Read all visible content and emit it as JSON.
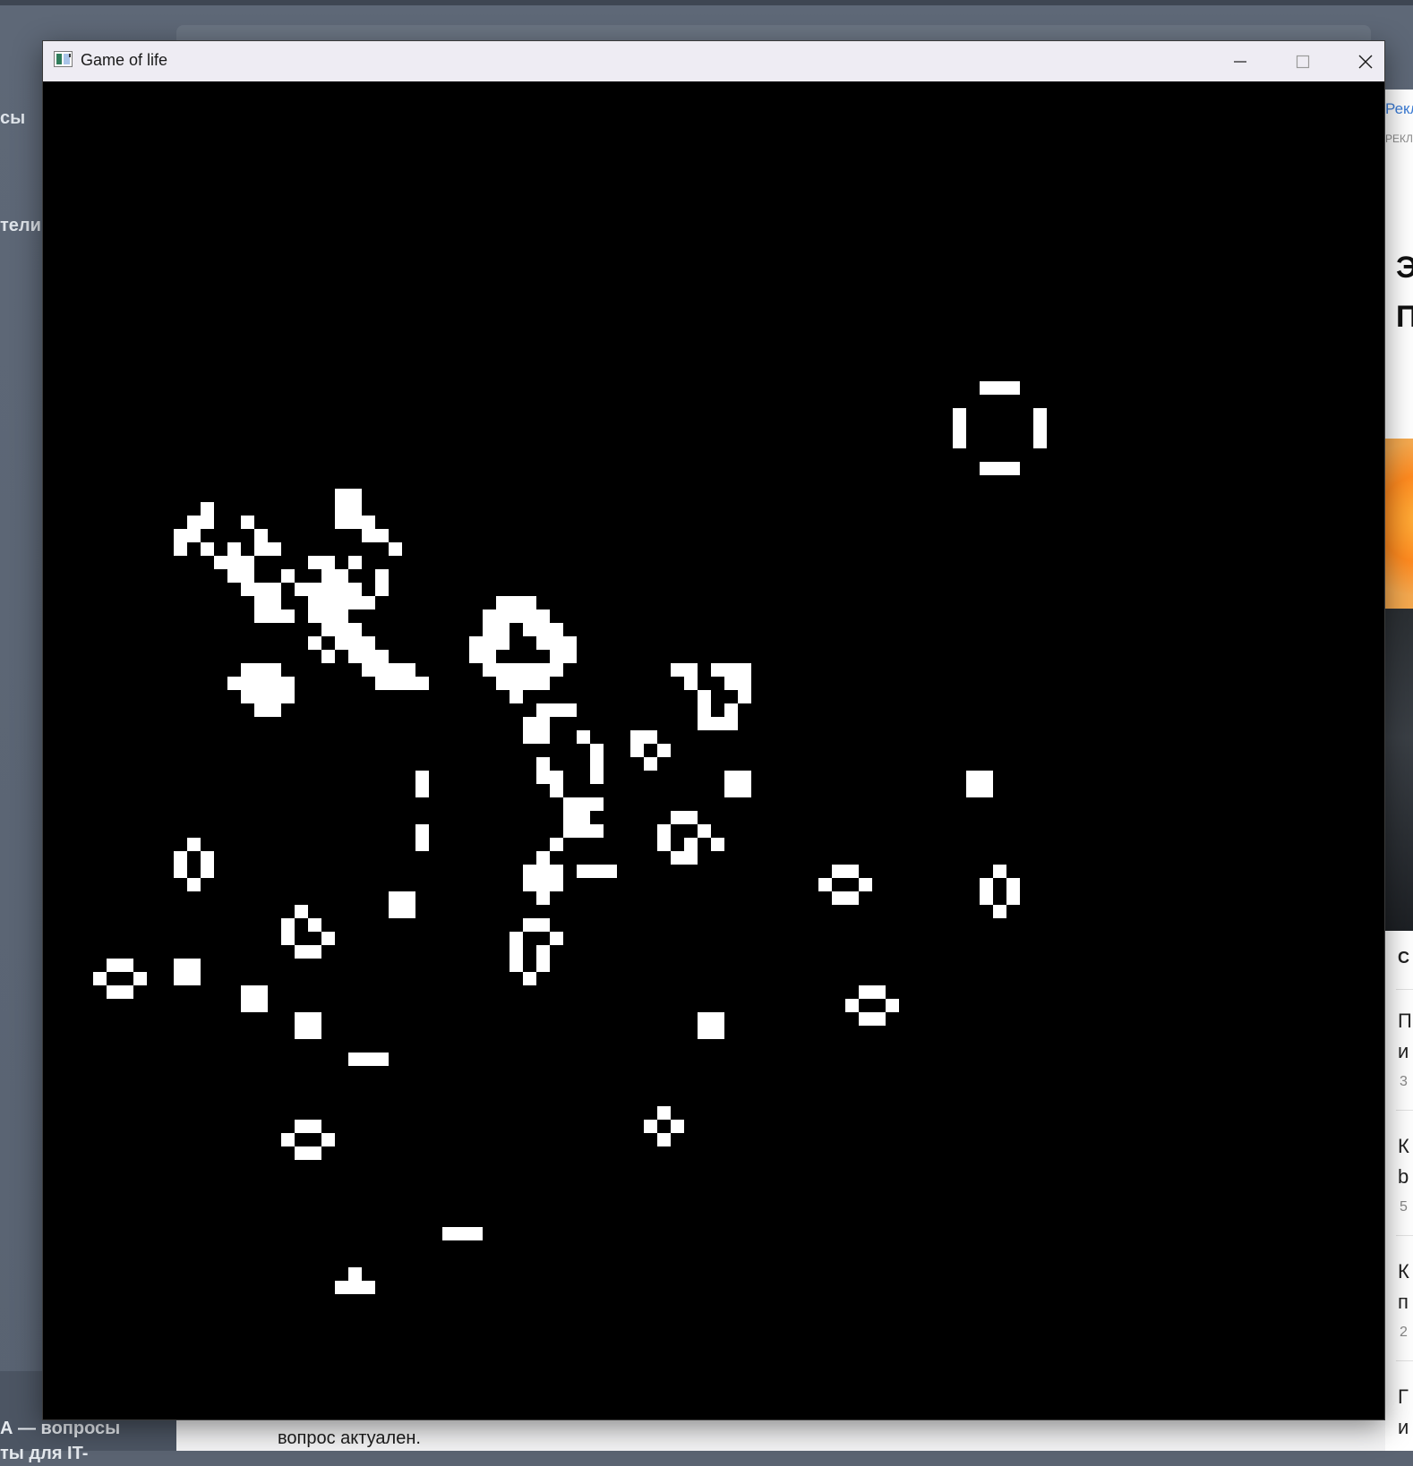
{
  "window": {
    "title": "Game of life",
    "icon": "app-icon",
    "controls": {
      "minimize": "minimize-icon",
      "maximize": "maximize-icon",
      "close": "close-icon"
    }
  },
  "game": {
    "alive_color": "#ffffff",
    "dead_color": "#000000",
    "cell_size": 15,
    "alive_cells": [
      [
        70,
        23
      ],
      [
        71,
        23
      ],
      [
        72,
        23
      ],
      [
        68,
        25
      ],
      [
        74,
        25
      ],
      [
        68,
        26
      ],
      [
        74,
        26
      ],
      [
        68,
        27
      ],
      [
        74,
        27
      ],
      [
        70,
        29
      ],
      [
        71,
        29
      ],
      [
        72,
        29
      ],
      [
        22,
        31
      ],
      [
        23,
        31
      ],
      [
        22,
        32
      ],
      [
        23,
        32
      ],
      [
        22,
        33
      ],
      [
        23,
        33
      ],
      [
        24,
        33
      ],
      [
        24,
        34
      ],
      [
        25,
        34
      ],
      [
        12,
        32
      ],
      [
        11,
        33
      ],
      [
        12,
        33
      ],
      [
        15,
        33
      ],
      [
        10,
        34
      ],
      [
        11,
        34
      ],
      [
        16,
        34
      ],
      [
        10,
        35
      ],
      [
        12,
        35
      ],
      [
        16,
        35
      ],
      [
        13,
        36
      ],
      [
        14,
        35
      ],
      [
        17,
        35
      ],
      [
        26,
        35
      ],
      [
        13,
        36
      ],
      [
        14,
        36
      ],
      [
        15,
        36
      ],
      [
        20,
        36
      ],
      [
        21,
        36
      ],
      [
        23,
        36
      ],
      [
        14,
        37
      ],
      [
        15,
        37
      ],
      [
        18,
        37
      ],
      [
        21,
        37
      ],
      [
        22,
        37
      ],
      [
        25,
        37
      ],
      [
        15,
        38
      ],
      [
        16,
        38
      ],
      [
        17,
        38
      ],
      [
        19,
        38
      ],
      [
        20,
        38
      ],
      [
        21,
        38
      ],
      [
        22,
        38
      ],
      [
        23,
        38
      ],
      [
        25,
        38
      ],
      [
        16,
        39
      ],
      [
        17,
        39
      ],
      [
        20,
        39
      ],
      [
        21,
        39
      ],
      [
        22,
        39
      ],
      [
        23,
        39
      ],
      [
        24,
        39
      ],
      [
        16,
        40
      ],
      [
        17,
        40
      ],
      [
        18,
        40
      ],
      [
        20,
        40
      ],
      [
        21,
        40
      ],
      [
        22,
        40
      ],
      [
        21,
        41
      ],
      [
        22,
        41
      ],
      [
        23,
        41
      ],
      [
        20,
        42
      ],
      [
        22,
        42
      ],
      [
        23,
        42
      ],
      [
        24,
        42
      ],
      [
        21,
        43
      ],
      [
        23,
        43
      ],
      [
        24,
        43
      ],
      [
        25,
        43
      ],
      [
        24,
        44
      ],
      [
        25,
        44
      ],
      [
        26,
        44
      ],
      [
        27,
        44
      ],
      [
        25,
        45
      ],
      [
        26,
        45
      ],
      [
        27,
        45
      ],
      [
        28,
        45
      ],
      [
        34,
        39
      ],
      [
        35,
        39
      ],
      [
        36,
        39
      ],
      [
        33,
        40
      ],
      [
        34,
        40
      ],
      [
        35,
        40
      ],
      [
        36,
        40
      ],
      [
        37,
        40
      ],
      [
        33,
        41
      ],
      [
        34,
        41
      ],
      [
        36,
        41
      ],
      [
        37,
        41
      ],
      [
        38,
        41
      ],
      [
        32,
        42
      ],
      [
        33,
        42
      ],
      [
        34,
        42
      ],
      [
        37,
        42
      ],
      [
        38,
        42
      ],
      [
        39,
        42
      ],
      [
        32,
        43
      ],
      [
        33,
        43
      ],
      [
        38,
        43
      ],
      [
        39,
        43
      ],
      [
        33,
        44
      ],
      [
        34,
        44
      ],
      [
        35,
        44
      ],
      [
        36,
        44
      ],
      [
        37,
        44
      ],
      [
        38,
        44
      ],
      [
        34,
        45
      ],
      [
        35,
        45
      ],
      [
        36,
        45
      ],
      [
        37,
        45
      ],
      [
        35,
        46
      ],
      [
        15,
        44
      ],
      [
        16,
        44
      ],
      [
        17,
        44
      ],
      [
        14,
        45
      ],
      [
        15,
        45
      ],
      [
        16,
        45
      ],
      [
        17,
        45
      ],
      [
        18,
        45
      ],
      [
        15,
        46
      ],
      [
        16,
        46
      ],
      [
        17,
        46
      ],
      [
        18,
        46
      ],
      [
        16,
        47
      ],
      [
        17,
        47
      ],
      [
        37,
        47
      ],
      [
        38,
        47
      ],
      [
        39,
        47
      ],
      [
        36,
        48
      ],
      [
        37,
        48
      ],
      [
        36,
        49
      ],
      [
        37,
        49
      ],
      [
        40,
        49
      ],
      [
        47,
        44
      ],
      [
        48,
        44
      ],
      [
        50,
        44
      ],
      [
        51,
        44
      ],
      [
        52,
        44
      ],
      [
        48,
        45
      ],
      [
        51,
        45
      ],
      [
        52,
        45
      ],
      [
        49,
        46
      ],
      [
        52,
        46
      ],
      [
        49,
        47
      ],
      [
        51,
        47
      ],
      [
        50,
        48
      ],
      [
        51,
        48
      ],
      [
        49,
        48
      ],
      [
        44,
        49
      ],
      [
        45,
        49
      ],
      [
        44,
        50
      ],
      [
        46,
        50
      ],
      [
        45,
        51
      ],
      [
        37,
        51
      ],
      [
        37,
        52
      ],
      [
        41,
        50
      ],
      [
        41,
        51
      ],
      [
        41,
        52
      ],
      [
        38,
        52
      ],
      [
        38,
        53
      ],
      [
        39,
        54
      ],
      [
        40,
        54
      ],
      [
        41,
        54
      ],
      [
        39,
        55
      ],
      [
        40,
        55
      ],
      [
        39,
        56
      ],
      [
        40,
        56
      ],
      [
        41,
        56
      ],
      [
        38,
        57
      ],
      [
        37,
        58
      ],
      [
        36,
        59
      ],
      [
        37,
        59
      ],
      [
        38,
        59
      ],
      [
        36,
        60
      ],
      [
        37,
        60
      ],
      [
        38,
        60
      ],
      [
        37,
        61
      ],
      [
        40,
        59
      ],
      [
        41,
        59
      ],
      [
        42,
        59
      ],
      [
        28,
        52
      ],
      [
        28,
        53
      ],
      [
        28,
        56
      ],
      [
        28,
        57
      ],
      [
        51,
        52
      ],
      [
        52,
        52
      ],
      [
        51,
        53
      ],
      [
        52,
        53
      ],
      [
        69,
        52
      ],
      [
        70,
        52
      ],
      [
        69,
        53
      ],
      [
        70,
        53
      ],
      [
        47,
        55
      ],
      [
        48,
        55
      ],
      [
        46,
        56
      ],
      [
        49,
        56
      ],
      [
        46,
        57
      ],
      [
        48,
        57
      ],
      [
        50,
        57
      ],
      [
        47,
        58
      ],
      [
        48,
        58
      ],
      [
        11,
        57
      ],
      [
        10,
        58
      ],
      [
        12,
        58
      ],
      [
        10,
        59
      ],
      [
        12,
        59
      ],
      [
        11,
        60
      ],
      [
        59,
        59
      ],
      [
        60,
        59
      ],
      [
        58,
        60
      ],
      [
        61,
        60
      ],
      [
        59,
        61
      ],
      [
        60,
        61
      ],
      [
        71,
        59
      ],
      [
        70,
        60
      ],
      [
        72,
        60
      ],
      [
        70,
        61
      ],
      [
        72,
        61
      ],
      [
        71,
        62
      ],
      [
        26,
        61
      ],
      [
        27,
        61
      ],
      [
        26,
        62
      ],
      [
        27,
        62
      ],
      [
        19,
        62
      ],
      [
        18,
        63
      ],
      [
        20,
        63
      ],
      [
        18,
        64
      ],
      [
        21,
        64
      ],
      [
        19,
        65
      ],
      [
        20,
        65
      ],
      [
        36,
        63
      ],
      [
        37,
        63
      ],
      [
        35,
        64
      ],
      [
        38,
        64
      ],
      [
        35,
        65
      ],
      [
        37,
        65
      ],
      [
        35,
        66
      ],
      [
        37,
        66
      ],
      [
        36,
        67
      ],
      [
        5,
        66
      ],
      [
        6,
        66
      ],
      [
        4,
        67
      ],
      [
        7,
        67
      ],
      [
        5,
        68
      ],
      [
        6,
        68
      ],
      [
        10,
        66
      ],
      [
        11,
        66
      ],
      [
        10,
        67
      ],
      [
        11,
        67
      ],
      [
        15,
        68
      ],
      [
        16,
        68
      ],
      [
        15,
        69
      ],
      [
        16,
        69
      ],
      [
        19,
        70
      ],
      [
        20,
        70
      ],
      [
        19,
        71
      ],
      [
        20,
        71
      ],
      [
        49,
        70
      ],
      [
        50,
        70
      ],
      [
        49,
        71
      ],
      [
        50,
        71
      ],
      [
        61,
        68
      ],
      [
        62,
        68
      ],
      [
        60,
        69
      ],
      [
        63,
        69
      ],
      [
        61,
        70
      ],
      [
        62,
        70
      ],
      [
        23,
        73
      ],
      [
        24,
        73
      ],
      [
        25,
        73
      ],
      [
        19,
        78
      ],
      [
        20,
        78
      ],
      [
        18,
        79
      ],
      [
        21,
        79
      ],
      [
        19,
        80
      ],
      [
        20,
        80
      ],
      [
        46,
        77
      ],
      [
        45,
        78
      ],
      [
        47,
        78
      ],
      [
        46,
        79
      ],
      [
        30,
        86
      ],
      [
        31,
        86
      ],
      [
        32,
        86
      ],
      [
        23,
        89
      ],
      [
        22,
        90
      ],
      [
        23,
        90
      ],
      [
        24,
        90
      ]
    ]
  }
}
